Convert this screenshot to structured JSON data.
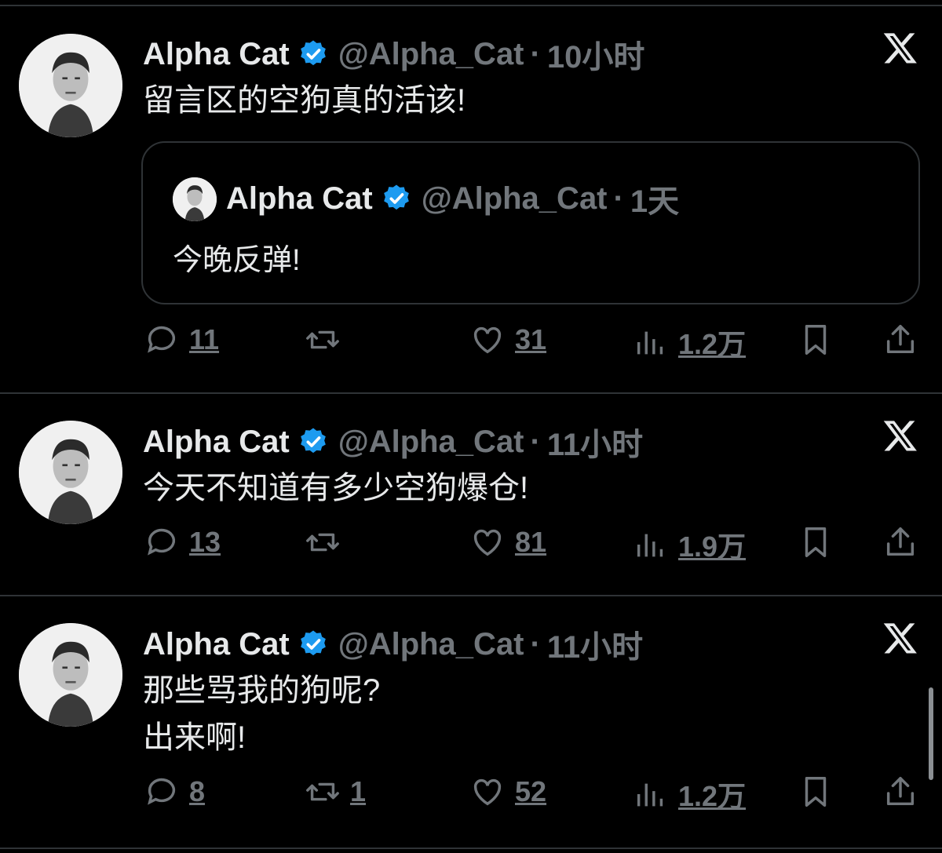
{
  "tweets": [
    {
      "author_name": "Alpha Cat",
      "handle": "@Alpha_Cat",
      "separator": "·",
      "time": "10小时",
      "text": "留言区的空狗真的活该!",
      "quote": {
        "author_name": "Alpha Cat",
        "handle": "@Alpha_Cat",
        "separator": "·",
        "time": "1天",
        "text": "今晚反弹!"
      },
      "replies": "11",
      "retweets": "",
      "likes": "31",
      "views": "1.2万"
    },
    {
      "author_name": "Alpha Cat",
      "handle": "@Alpha_Cat",
      "separator": "·",
      "time": "11小时",
      "text": "今天不知道有多少空狗爆仓!",
      "replies": "13",
      "retweets": "",
      "likes": "81",
      "views": "1.9万"
    },
    {
      "author_name": "Alpha Cat",
      "handle": "@Alpha_Cat",
      "separator": "·",
      "time": "11小时",
      "text": "那些骂我的狗呢?\n出来啊!",
      "replies": "8",
      "retweets": "1",
      "likes": "52",
      "views": "1.2万"
    }
  ],
  "colors": {
    "background": "#000000",
    "text_primary": "#e7e9ea",
    "text_secondary": "#71767b",
    "verified_badge": "#1d9bf0",
    "divider": "#2f3336"
  },
  "icons": [
    "reply-icon",
    "retweet-icon",
    "like-icon",
    "views-icon",
    "bookmark-icon",
    "share-icon",
    "verified-icon",
    "x-logo-icon"
  ]
}
